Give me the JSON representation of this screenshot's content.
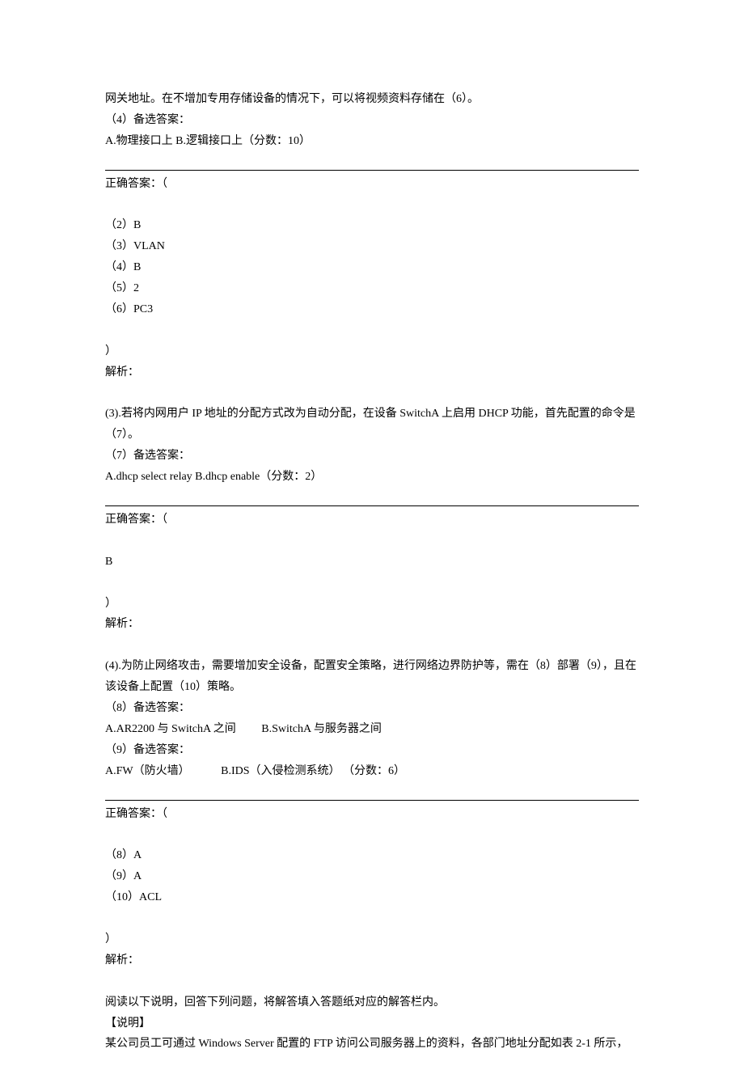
{
  "q2": {
    "intro1": "网关地址。在不增加专用存储设备的情况下，可以将视频资料存储在（6）。",
    "opt4_label": "（4）备选答案：",
    "opt4_choices": "A.物理接口上 B.逻辑接口上（分数：10）",
    "answer_label": "正确答案：（",
    "a2": "（2）B",
    "a3": "（3）VLAN",
    "a4": "（4）B",
    "a5": "（5）2",
    "a6": "（6）PC3",
    "close": "）",
    "parse_label": "解析："
  },
  "q3": {
    "text": "(3).若将内网用户 IP 地址的分配方式改为自动分配，在设备 SwitchA 上启用 DHCP 功能，首先配置的命令是（7）。",
    "opt7_label": "（7）备选答案：",
    "opt7_choices": "A.dhcp select relay B.dhcp enable（分数：2）",
    "answer_label": "正确答案：（",
    "a": "B",
    "close": "）",
    "parse_label": "解析："
  },
  "q4": {
    "text": "(4).为防止网络攻击，需要增加安全设备，配置安全策略，进行网络边界防护等，需在（8）部署（9），且在该设备上配置（10）策略。",
    "opt8_label": "（8）备选答案：",
    "opt8_choices": "A.AR2200 与 SwitchA 之间         B.SwitchA 与服务器之间",
    "opt9_label": "（9）备选答案：",
    "opt9_choices": "A.FW（防火墙）           B.IDS（入侵检测系统） （分数：6）",
    "answer_label": "正确答案：（",
    "a8": "（8）A",
    "a9": "（9）A",
    "a10": "（10）ACL",
    "close": "）",
    "parse_label": "解析："
  },
  "q5": {
    "intro": "阅读以下说明，回答下列问题，将解答填入答题纸对应的解答栏内。",
    "shuoming": "【说明】",
    "body": "某公司员工可通过 Windows Server 配置的 FTP 访问公司服务器上的资料，各部门地址分配如表 2-1 所示，"
  }
}
